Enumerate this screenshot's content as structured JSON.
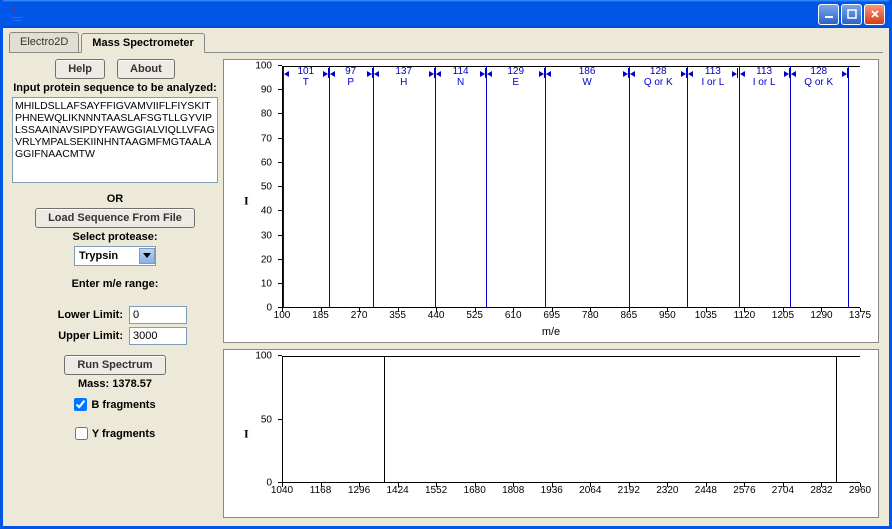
{
  "window": {
    "title": ""
  },
  "tabs": {
    "electro2d": "Electro2D",
    "mass_spec": "Mass Spectrometer"
  },
  "left": {
    "help": "Help",
    "about": "About",
    "input_label": "Input protein sequence to be analyzed:",
    "sequence": "MHILDSLLAFSAYFFIGVAMVIIFLFIYSKITPHNEWQLIKNNNTAASLAFSGTLLGYVIPLSSAAINAVSIPDYFAWGGIALVIQLLVFAGVRLYMPALSEKIINHNTAAGMFMGTAALAGGIFNAACMTW",
    "or": "OR",
    "load_file": "Load Sequence From File",
    "select_protease": "Select protease:",
    "protease": "Trypsin",
    "enter_me": "Enter m/e range:",
    "lower_label": "Lower Limit:",
    "upper_label": "Upper Limit:",
    "lower_val": "0",
    "upper_val": "3000",
    "run": "Run Spectrum",
    "mass": "Mass: 1378.57",
    "b_frag": "B fragments",
    "y_frag": "Y fragments"
  },
  "chart_data": [
    {
      "type": "bar",
      "ylabel": "I",
      "xlabel": "m/e",
      "xlim": [
        100,
        1375
      ],
      "ylim": [
        0,
        100
      ],
      "x_ticks": [
        100,
        185,
        270,
        355,
        440,
        525,
        610,
        695,
        780,
        865,
        950,
        1035,
        1120,
        1205,
        1290,
        1375
      ],
      "y_ticks": [
        0,
        10,
        20,
        30,
        40,
        50,
        60,
        70,
        80,
        90,
        100
      ],
      "peaks_me": [
        102,
        203,
        300,
        437,
        551,
        680,
        866,
        994,
        1107,
        1220,
        1348
      ],
      "fragments": [
        {
          "from": 102,
          "to": 203,
          "diff": 101,
          "aa": "T"
        },
        {
          "from": 203,
          "to": 300,
          "diff": 97,
          "aa": "P"
        },
        {
          "from": 300,
          "to": 437,
          "diff": 137,
          "aa": "H"
        },
        {
          "from": 437,
          "to": 551,
          "diff": 114,
          "aa": "N"
        },
        {
          "from": 551,
          "to": 680,
          "diff": 129,
          "aa": "E"
        },
        {
          "from": 680,
          "to": 866,
          "diff": 186,
          "aa": "W"
        },
        {
          "from": 866,
          "to": 994,
          "diff": 128,
          "aa": "Q or K"
        },
        {
          "from": 994,
          "to": 1107,
          "diff": 113,
          "aa": "I or L"
        },
        {
          "from": 1107,
          "to": 1220,
          "diff": 113,
          "aa": "I or L"
        },
        {
          "from": 1220,
          "to": 1348,
          "diff": 128,
          "aa": "Q or K"
        }
      ]
    },
    {
      "type": "bar",
      "ylabel": "I",
      "xlabel": "",
      "xlim": [
        1040,
        2960
      ],
      "ylim": [
        0,
        100
      ],
      "x_ticks": [
        1040,
        1168,
        1296,
        1424,
        1552,
        1680,
        1808,
        1936,
        2064,
        2192,
        2320,
        2448,
        2576,
        2704,
        2832,
        2960
      ],
      "y_ticks": [
        0,
        50,
        100
      ],
      "peaks_me": [
        1378.57,
        2880
      ]
    }
  ]
}
